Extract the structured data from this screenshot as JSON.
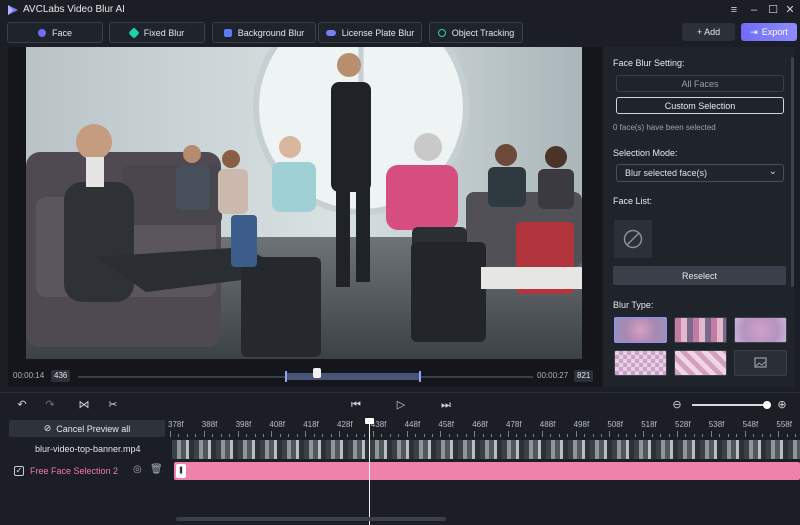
{
  "app": {
    "title": "AVCLabs Video Blur AI"
  },
  "window": {
    "menu_icon": "hamburger-icon",
    "minimize_icon": "minimize-icon",
    "maximize_icon": "maximize-icon",
    "close_icon": "close-icon"
  },
  "toolbar": {
    "tabs": [
      {
        "label": "Face",
        "icon": "face-icon",
        "color": "#6f6cf6"
      },
      {
        "label": "Fixed Blur",
        "icon": "fixed-blur-icon",
        "color": "#1fd0b0"
      },
      {
        "label": "Background Blur",
        "icon": "background-blur-icon",
        "color": "#5c7cf5"
      },
      {
        "label": "License Plate Blur",
        "icon": "car-icon",
        "color": "#7a7ef7"
      },
      {
        "label": "Object Tracking",
        "icon": "tracking-icon",
        "color": "#2ed3a3"
      }
    ],
    "add_label": "+ Add",
    "export_label": "Export"
  },
  "preview": {
    "start_time": "00:00:14",
    "start_frame": "436",
    "end_time": "00:00:27",
    "end_frame": "821"
  },
  "settings": {
    "face_blur_setting_label": "Face Blur Setting:",
    "all_faces_label": "All Faces",
    "custom_selection_label": "Custom Selection",
    "faces_selected_text": "0 face(s) have been selected",
    "selection_mode_label": "Selection Mode:",
    "selection_mode_value": "Blur selected face(s)",
    "face_list_label": "Face List:",
    "reselect_label": "Reselect",
    "blur_type_label": "Blur Type:"
  },
  "timeline": {
    "cancel_preview_label": "Cancel Preview all",
    "video_track_name": "blur-video-top-banner.mp4",
    "blur_track_name": "Free Face Selection 2",
    "ruler_labels": [
      "378f",
      "388f",
      "398f",
      "408f",
      "418f",
      "428f",
      "438f",
      "448f",
      "458f",
      "468f",
      "478f",
      "488f",
      "498f",
      "508f",
      "518f",
      "528f",
      "538f",
      "548f",
      "558f"
    ]
  },
  "colors": {
    "accent": "#6f6cf6",
    "blur_track": "#ee82aa",
    "background": "#1b1e25"
  }
}
